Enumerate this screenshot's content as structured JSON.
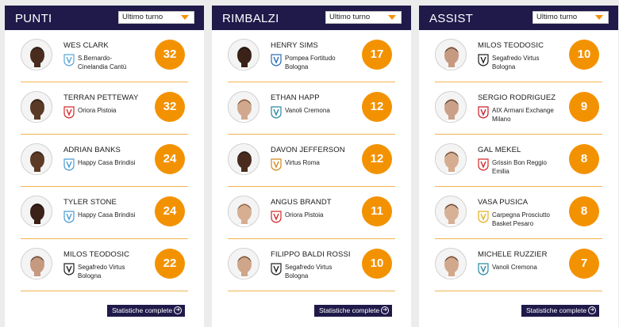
{
  "colors": {
    "header_bg": "#1f1a4a",
    "accent": "#f39200",
    "divider": "#f0b64e"
  },
  "nav": {
    "prev_icon": "chevron-left-icon",
    "next_icon": "chevron-right-icon"
  },
  "panels": [
    {
      "title": "PUNTI",
      "dropdown": "Ultimo turno",
      "button": "Statistiche complete",
      "rows": [
        {
          "name": "WES CLARK",
          "team1": "S.Bernardo-",
          "team2": "Cinelandia Cantù",
          "value": "32",
          "skin": "#4a2c1e",
          "hair": "#1a1a1a",
          "logo": "#5aa6d6"
        },
        {
          "name": "TERRAN PETTEWAY",
          "team1": "Oriora Pistoia",
          "team2": "",
          "value": "32",
          "skin": "#5a3a26",
          "hair": "#1c1410",
          "logo": "#d42a2a"
        },
        {
          "name": "ADRIAN BANKS",
          "team1": "Happy Casa Brindisi",
          "team2": "",
          "value": "24",
          "skin": "#5c3a25",
          "hair": "#2a1d14",
          "logo": "#4a9bd4"
        },
        {
          "name": "TYLER STONE",
          "team1": "Happy Casa Brindisi",
          "team2": "",
          "value": "24",
          "skin": "#3a2218",
          "hair": "#141010",
          "logo": "#4a9bd4"
        },
        {
          "name": "MILOS TEODOSIC",
          "team1": "Segafredo Virtus",
          "team2": "Bologna",
          "value": "22",
          "skin": "#c69a80",
          "hair": "#3a2a20",
          "logo": "#222222"
        }
      ]
    },
    {
      "title": "RIMBALZI",
      "dropdown": "Ultimo turno",
      "button": "Statistiche complete",
      "rows": [
        {
          "name": "HENRY SIMS",
          "team1": "Pompea Fortitudo",
          "team2": "Bologna",
          "value": "17",
          "skin": "#3a2218",
          "hair": "#141010",
          "logo": "#2c6fb5"
        },
        {
          "name": "ETHAN HAPP",
          "team1": "Vanoli Cremona",
          "team2": "",
          "value": "12",
          "skin": "#d1a88d",
          "hair": "#5a3a22",
          "logo": "#2a8aa0"
        },
        {
          "name": "DAVON JEFFERSON",
          "team1": "Virtus Roma",
          "team2": "",
          "value": "12",
          "skin": "#4a2c1e",
          "hair": "#1a1a1a",
          "logo": "#d4881e"
        },
        {
          "name": "ANGUS BRANDT",
          "team1": "Oriora Pistoia",
          "team2": "",
          "value": "11",
          "skin": "#d8ae93",
          "hair": "#6a4a30",
          "logo": "#d42a2a"
        },
        {
          "name": "FILIPPO BALDI ROSSI",
          "team1": "Segafredo Virtus",
          "team2": "Bologna",
          "value": "10",
          "skin": "#d0a68a",
          "hair": "#4a3424",
          "logo": "#222222"
        }
      ]
    },
    {
      "title": "ASSIST",
      "dropdown": "Ultimo turno",
      "button": "Statistiche complete",
      "rows": [
        {
          "name": "MILOS TEODOSIC",
          "team1": "Segafredo Virtus",
          "team2": "Bologna",
          "value": "10",
          "skin": "#c69a80",
          "hair": "#3a2a20",
          "logo": "#222222"
        },
        {
          "name": "SERGIO RODRIGUEZ",
          "team1": "AIX Armani Exchange",
          "team2": "Milano",
          "value": "9",
          "skin": "#caa088",
          "hair": "#2a2020",
          "logo": "#c8202a"
        },
        {
          "name": "GAL MEKEL",
          "team1": "Grissin Bon Reggio",
          "team2": "Emilia",
          "value": "8",
          "skin": "#d6ad90",
          "hair": "#3a2a1c",
          "logo": "#d42a2a"
        },
        {
          "name": "VASA PUSICA",
          "team1": "Carpegna Prosciutto",
          "team2": "Basket Pesaro",
          "value": "8",
          "skin": "#d8b096",
          "hair": "#2a1e16",
          "logo": "#e0b020"
        },
        {
          "name": "MICHELE RUZZIER",
          "team1": "Vanoli Cremona",
          "team2": "",
          "value": "7",
          "skin": "#d2a88c",
          "hair": "#3a2a20",
          "logo": "#2a8aa0"
        }
      ]
    }
  ]
}
